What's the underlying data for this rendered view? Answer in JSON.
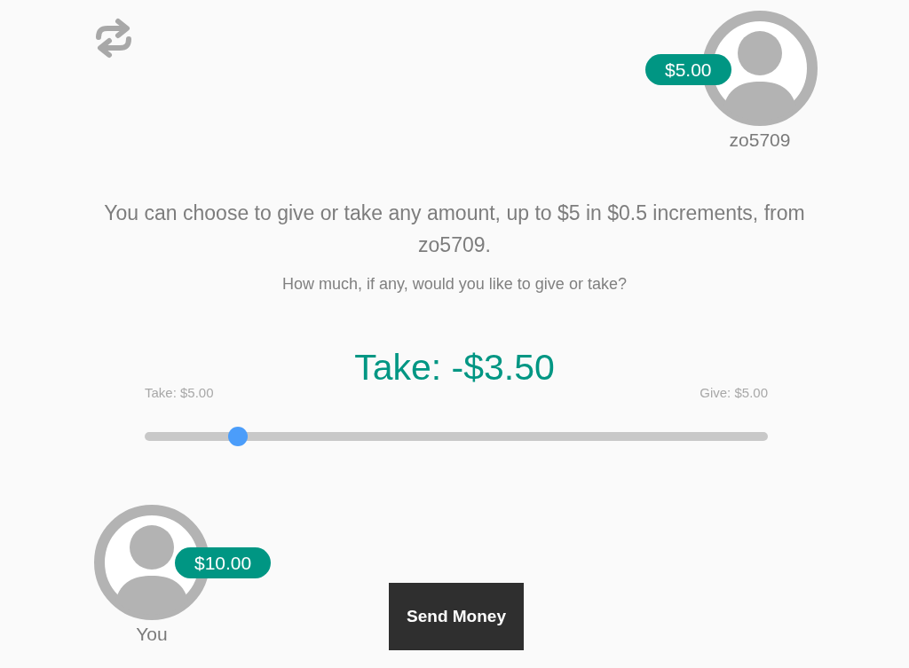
{
  "opponent": {
    "name": "zo5709",
    "balance": "$5.00"
  },
  "message": "You can choose to give or take any amount, up to $5 in $0.5 increments, from zo5709.",
  "question": "How much, if any, would you like to give or take?",
  "amount": "Take: -$3.50",
  "slider": {
    "min_label": "Take: $5.00",
    "max_label": "Give: $5.00",
    "level": 0.15
  },
  "player": {
    "name": "You",
    "balance": "$10.00"
  },
  "send_button": "Send Money"
}
